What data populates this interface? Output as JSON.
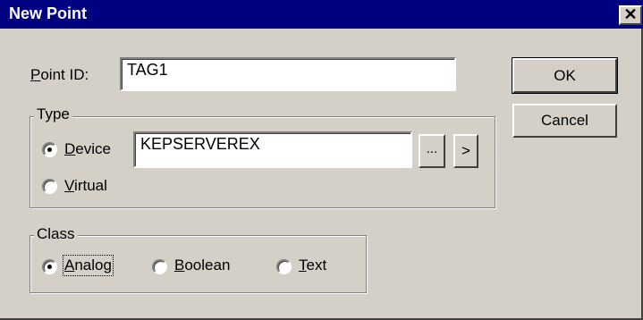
{
  "dialog": {
    "title": "New Point",
    "close_glyph": "✕"
  },
  "point_id": {
    "label_prefix": "P",
    "label_rest": "oint ID:",
    "value": "TAG1"
  },
  "buttons": {
    "ok": "OK",
    "cancel": "Cancel",
    "browse": "...",
    "go": ">"
  },
  "type_group": {
    "legend": "Type",
    "device": {
      "label_u": "D",
      "label_rest": "evice",
      "selected": true,
      "value": "KEPSERVEREX"
    },
    "virtual": {
      "label_u": "V",
      "label_rest": "irtual",
      "selected": false
    }
  },
  "class_group": {
    "legend": "Class",
    "analog": {
      "label_u": "A",
      "label_rest": "nalog",
      "selected": true
    },
    "boolean": {
      "label_u": "B",
      "label_rest": "oolean",
      "selected": false
    },
    "text": {
      "label_u": "T",
      "label_rest": "ext",
      "selected": false
    }
  }
}
